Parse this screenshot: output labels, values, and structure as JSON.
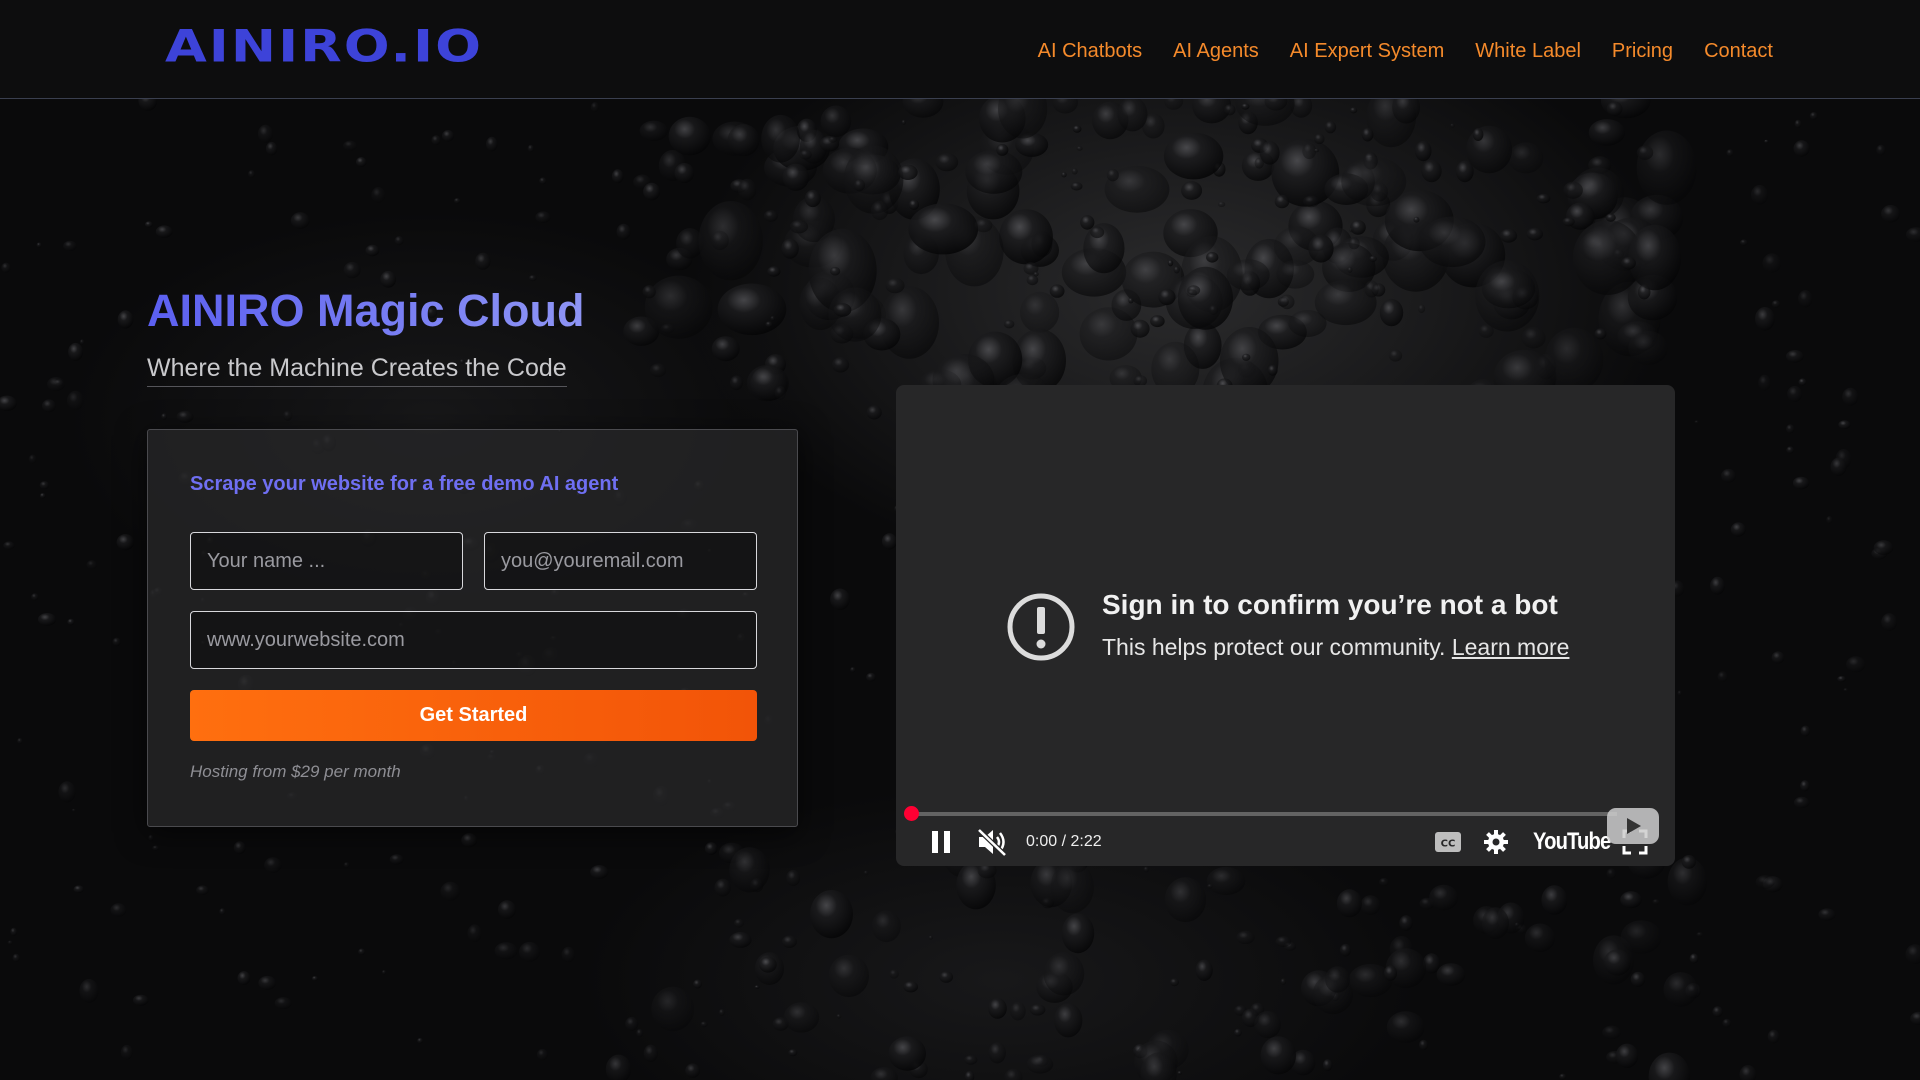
{
  "header": {
    "logo": "AINIRO.IO",
    "nav": [
      "AI Chatbots",
      "AI Agents",
      "AI Expert System",
      "White Label",
      "Pricing",
      "Contact"
    ]
  },
  "hero": {
    "title": "AINIRO Magic Cloud",
    "subtitle": "Where the Machine Creates the Code"
  },
  "form": {
    "heading": "Scrape your website for a free demo AI agent",
    "name_placeholder": "Your name ...",
    "email_placeholder": "you@youremail.com",
    "website_placeholder": "www.yourwebsite.com",
    "submit_label": "Get Started",
    "note": "Hosting from $29 per month"
  },
  "video": {
    "title": "Sign in to confirm you’re not a bot",
    "message": "This helps protect our community.",
    "learn_more": "Learn more",
    "time": "0:00 / 2:22",
    "progress": 0,
    "brand": "YouTube",
    "icons": [
      "alert-icon",
      "pause-icon",
      "mute-icon",
      "cc-icon",
      "gear-icon",
      "fullscreen-icon",
      "play-icon"
    ]
  },
  "colors": {
    "logo": "#3d43d9",
    "nav_link": "#f58a2b",
    "accent_purple": "#6f6ff2",
    "button_orange": "#ff6f0f",
    "progress_red": "#ff0033",
    "background": "#0a0a0b"
  }
}
